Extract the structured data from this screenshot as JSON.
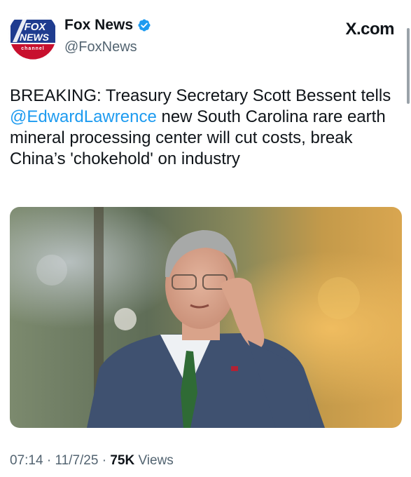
{
  "account": {
    "display_name": "Fox News",
    "handle": "@FoxNews",
    "avatar_icon": "fox-news-channel-logo",
    "verified_icon": "verified-badge-icon",
    "verified_color": "#1d9bf0"
  },
  "platform": {
    "label": "X.com"
  },
  "tweet": {
    "text_before": "BREAKING: Treasury Secretary Scott Bessent tells ",
    "mention": "@EdwardLawrence",
    "text_after": " new South Carolina rare earth mineral processing center will cut costs, break China’s 'chokehold' on industry",
    "mention_color": "#1d9bf0"
  },
  "meta": {
    "time": "07:14",
    "separator": "·",
    "date": "11/7/25",
    "views_count": "75K",
    "views_label": "Views"
  }
}
